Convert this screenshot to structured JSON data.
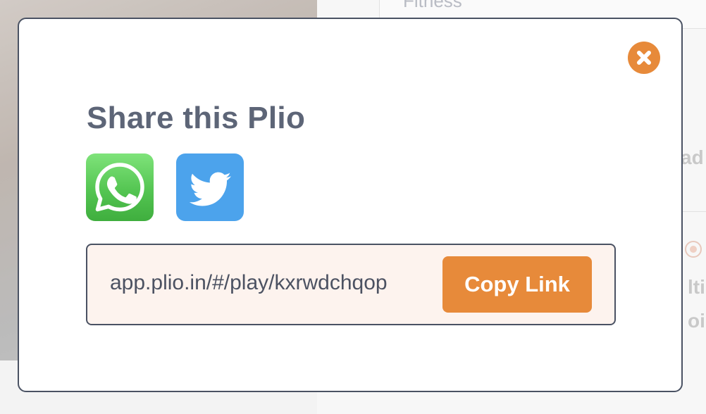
{
  "background": {
    "category_label": "Fitness",
    "fragment_1": "ad",
    "fragment_2": "lti",
    "fragment_3": "oi"
  },
  "modal": {
    "title": "Share this Plio",
    "share_buttons": [
      {
        "name": "WhatsApp",
        "icon": "whatsapp-icon",
        "color": "#54c552"
      },
      {
        "name": "Twitter",
        "icon": "twitter-icon",
        "color": "#4ca3ec"
      }
    ],
    "link": {
      "url": "app.plio.in/#/play/kxrwdchqop",
      "copy_label": "Copy Link"
    },
    "close_icon": "close-icon",
    "accent_color": "#e78a3a"
  }
}
